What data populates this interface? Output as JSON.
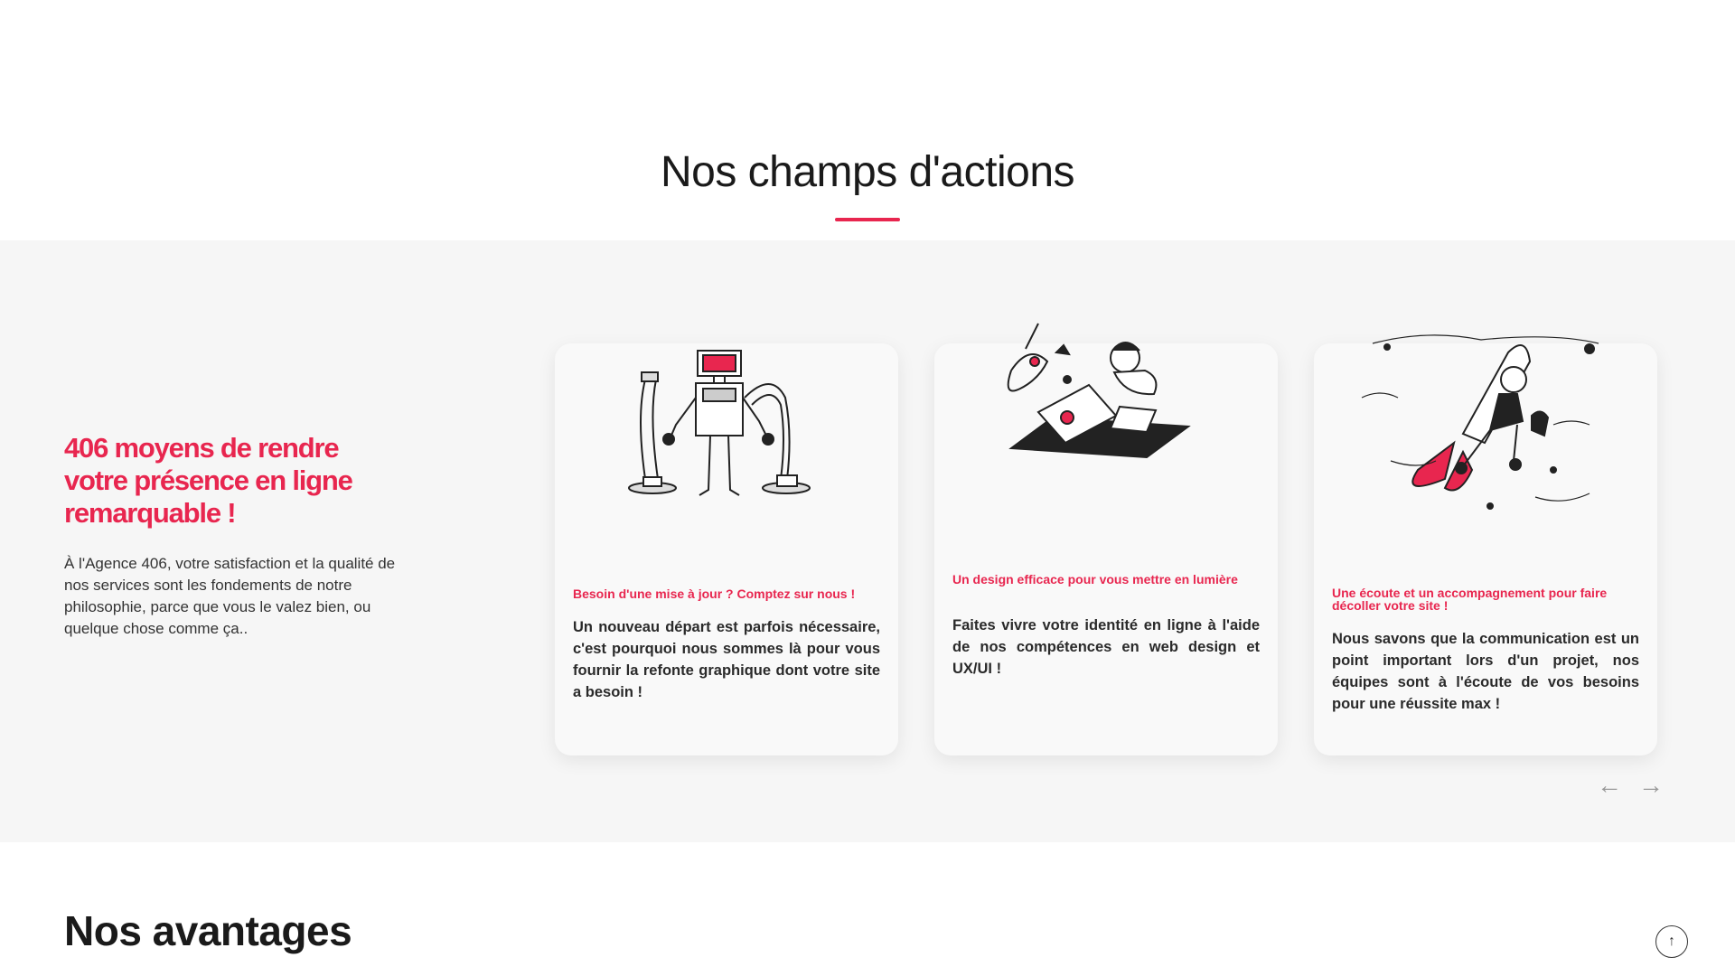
{
  "section": {
    "title": "Nos champs d'actions"
  },
  "intro": {
    "heading": "406 moyens de rendre votre présence en ligne remarquable !",
    "text": "À l'Agence 406, votre satisfaction et la qualité de nos services sont les fondements de notre philosophie, parce que vous le valez bien, ou quelque chose comme ça.."
  },
  "cards": [
    {
      "title": "Besoin d'une mise à jour ? Comptez sur nous !",
      "text": "Un nouveau départ est parfois nécessaire, c'est pourquoi nous sommes là pour vous fournir la refonte graphique dont votre site a besoin !",
      "icon": "robot-illustration"
    },
    {
      "title": "Un design efficace pour vous mettre en lumière",
      "text": "Faites vivre votre identité en ligne à l'aide de nos compétences en web design et UX/UI !",
      "icon": "designer-laptop-illustration"
    },
    {
      "title": "Une écoute et un accompagnement pour faire décoller votre site !",
      "text": "Nous savons que la communication est un point important lors d'un projet, nos équipes sont à l'écoute de vos besoins pour une réussite max !",
      "icon": "rocket-illustration"
    }
  ],
  "carousel": {
    "prev": "←",
    "next": "→"
  },
  "advantages": {
    "title": "Nos avantages"
  },
  "scroll_top": {
    "glyph": "↑"
  },
  "colors": {
    "accent": "#e8264f",
    "band": "#f6f6f6",
    "text": "#1a1a1a"
  }
}
